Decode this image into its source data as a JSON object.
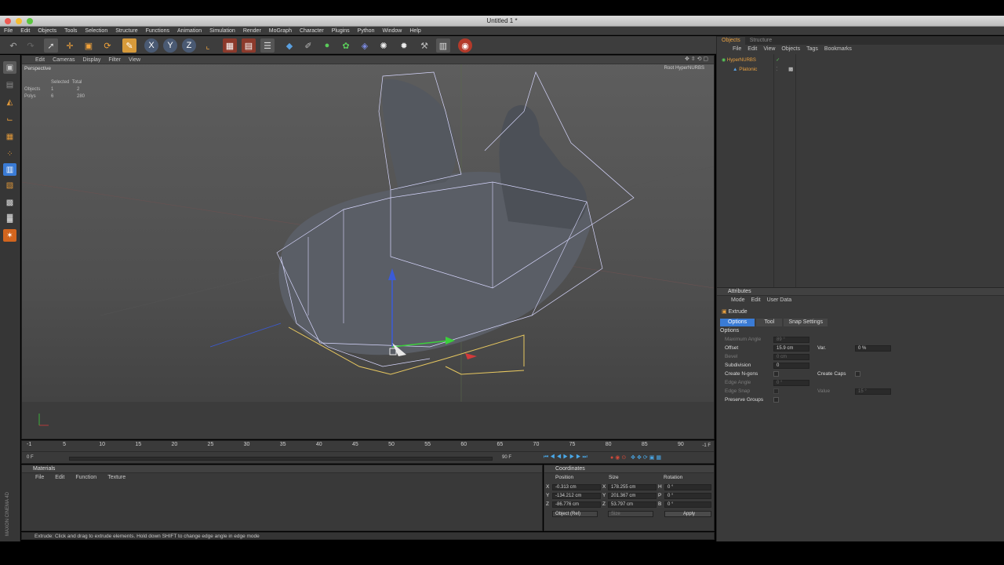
{
  "window": {
    "title": "Untitled 1 *"
  },
  "menu": [
    "File",
    "Edit",
    "Objects",
    "Tools",
    "Selection",
    "Structure",
    "Functions",
    "Animation",
    "Simulation",
    "Render",
    "MoGraph",
    "Character",
    "Plugins",
    "Python",
    "Window",
    "Help"
  ],
  "viewport": {
    "menu": [
      "Edit",
      "Cameras",
      "Display",
      "Filter",
      "View"
    ],
    "name": "Perspective",
    "right_label": "Root  HyperNURBS",
    "stats": {
      "selected_header": "Selected",
      "total_header": "Total",
      "objects_label": "Objects",
      "objects_selected": "1",
      "objects_total": "2",
      "polys_label": "Polys",
      "polys_selected": "6",
      "polys_total": "280"
    }
  },
  "timeline": {
    "ticks": [
      "-1",
      "5",
      "10",
      "15",
      "20",
      "25",
      "30",
      "35",
      "40",
      "45",
      "50",
      "55",
      "60",
      "65",
      "70",
      "75",
      "80",
      "85",
      "90"
    ],
    "start": "0 F",
    "end": "90 F",
    "end_frame": "-1 F"
  },
  "materials": {
    "title": "Materials",
    "menu": [
      "File",
      "Edit",
      "Function",
      "Texture"
    ]
  },
  "coordinates": {
    "title": "Coordinates",
    "headers": [
      "Position",
      "Size",
      "Rotation"
    ],
    "rows": [
      {
        "axis": "X",
        "pos": "-0.313 cm",
        "saxis": "X",
        "size": "178.255 cm",
        "raxis": "H",
        "rot": "0 °"
      },
      {
        "axis": "Y",
        "pos": "-134.212 cm",
        "saxis": "Y",
        "size": "201.367 cm",
        "raxis": "P",
        "rot": "0 °"
      },
      {
        "axis": "Z",
        "pos": "-86.776 cm",
        "saxis": "Z",
        "size": "53.797 cm",
        "raxis": "B",
        "rot": "0 °"
      }
    ],
    "mode": "Object (Rel)",
    "size_mode": "Size",
    "apply": "Apply"
  },
  "status": "Extrude: Click and drag to extrude elements. Hold down SHIFT to change edge angle in edge mode",
  "objects_panel": {
    "tabs": [
      "Objects",
      "Structure"
    ],
    "menu": [
      "File",
      "Edit",
      "View",
      "Objects",
      "Tags",
      "Bookmarks"
    ],
    "items": [
      {
        "name": "HyperNURBS"
      },
      {
        "name": "Platonic"
      }
    ]
  },
  "attributes": {
    "title": "Attributes",
    "menu": [
      "Mode",
      "Edit",
      "User Data"
    ],
    "tool_name": "Extrude",
    "tabs": [
      "Options",
      "Tool",
      "Snap Settings"
    ],
    "section": "Options",
    "fields": {
      "max_angle_label": "Maximum Angle",
      "max_angle": "89 °",
      "offset_label": "Offset",
      "offset": "15.9 cm",
      "var_label": "Var.",
      "var": "0 %",
      "bevel_label": "Bevel",
      "bevel": "0 cm",
      "subdivision_label": "Subdivision",
      "subdivision": "0",
      "create_ngons": "Create N-gons",
      "create_caps": "Create Caps",
      "edge_angle_label": "Edge Angle",
      "edge_angle": "0 °",
      "edge_snap_label": "Edge Snap",
      "value_label": "Value",
      "value": "15 °",
      "preserve_groups": "Preserve Groups"
    }
  },
  "brand": "MAXON CINEMA 4D",
  "colors": {
    "accent": "#3a7bd5",
    "x_axis": "#d23a3a",
    "y_axis": "#3ccf3c",
    "z_axis": "#3b5bd8"
  }
}
